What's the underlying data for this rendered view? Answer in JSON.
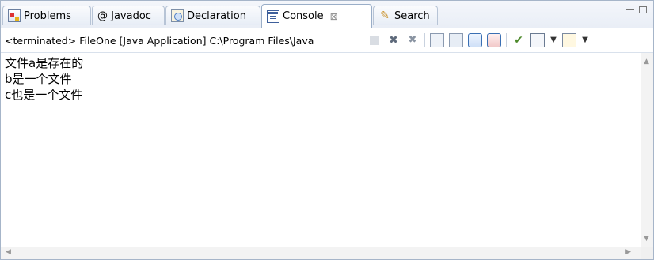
{
  "tabs": [
    {
      "label": "Problems",
      "icon": "problems-icon"
    },
    {
      "label": "@ Javadoc",
      "icon": "javadoc-icon"
    },
    {
      "label": "Declaration",
      "icon": "declaration-icon"
    },
    {
      "label": "Console",
      "icon": "console-icon",
      "close": "⊠"
    },
    {
      "label": "Search",
      "icon": "search-icon"
    }
  ],
  "status_text": "<terminated> FileOne [Java Application] C:\\Program Files\\Java",
  "console_lines": [
    "文件a是存在的",
    "b是一个文件",
    "c也是一个文件"
  ]
}
